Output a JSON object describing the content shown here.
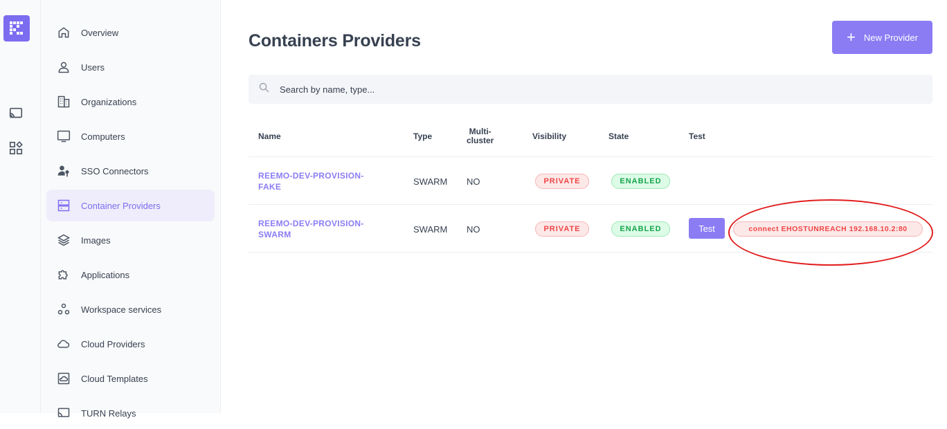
{
  "icons": {
    "logo": "app-logo-icon",
    "rail": [
      "cast-icon",
      "apps-icon"
    ],
    "search": "search-icon",
    "add": "plus-icon"
  },
  "colors": {
    "accent": "#8b7cf4",
    "danger": "#ef4444",
    "success": "#16a34a",
    "annotation": "#e11d1d"
  },
  "sidebar": {
    "items": [
      {
        "label": "Overview",
        "icon": "home-icon"
      },
      {
        "label": "Users",
        "icon": "user-icon"
      },
      {
        "label": "Organizations",
        "icon": "building-icon"
      },
      {
        "label": "Computers",
        "icon": "monitor-icon"
      },
      {
        "label": "SSO Connectors",
        "icon": "user-key-icon"
      },
      {
        "label": "Container Providers",
        "icon": "server-icon",
        "active": true
      },
      {
        "label": "Images",
        "icon": "layers-icon"
      },
      {
        "label": "Applications",
        "icon": "puzzle-icon"
      },
      {
        "label": "Workspace services",
        "icon": "services-icon"
      },
      {
        "label": "Cloud Providers",
        "icon": "cloud-icon"
      },
      {
        "label": "Cloud Templates",
        "icon": "cloud-template-icon"
      },
      {
        "label": "TURN Relays",
        "icon": "relay-icon"
      }
    ]
  },
  "header": {
    "title": "Containers Providers",
    "new_button": "New Provider"
  },
  "search": {
    "placeholder": "Search by name, type..."
  },
  "table": {
    "columns": [
      "Name",
      "Type",
      "Multi-\ncluster",
      "Visibility",
      "State",
      "Test"
    ],
    "rows": [
      {
        "name_line1": "REEMO-DEV-PROVISION-",
        "name_line2": "FAKE",
        "type": "SWARM",
        "multi": "NO",
        "visibility": "PRIVATE",
        "state": "ENABLED"
      },
      {
        "name_line1": "REEMO-DEV-PROVISION-",
        "name_line2": "SWARM",
        "type": "SWARM",
        "multi": "NO",
        "visibility": "PRIVATE",
        "state": "ENABLED",
        "test_button": "Test",
        "test_result": "connect EHOSTUNREACH 192.168.10.2:80"
      }
    ]
  }
}
